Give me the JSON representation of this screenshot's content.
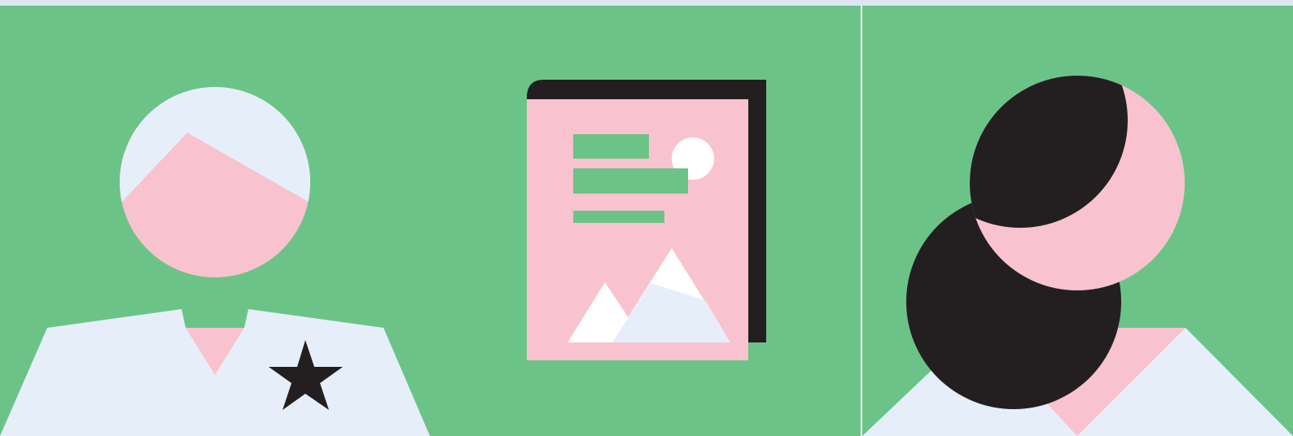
{
  "colors": {
    "top_strip": "#dbe7f1",
    "background": "#6cc388",
    "divider": "#ffffff",
    "pale_blue": "#e6eff9",
    "pink": "#f8c3cf",
    "dark": "#231f20",
    "white": "#ffffff"
  },
  "panels": {
    "left": {
      "figure": "person-with-short-hair",
      "badge_icon": "star-icon"
    },
    "center": {
      "figure": "photo-document-icon",
      "text_lines": 3
    },
    "right": {
      "figure": "person-with-ponytail"
    }
  }
}
